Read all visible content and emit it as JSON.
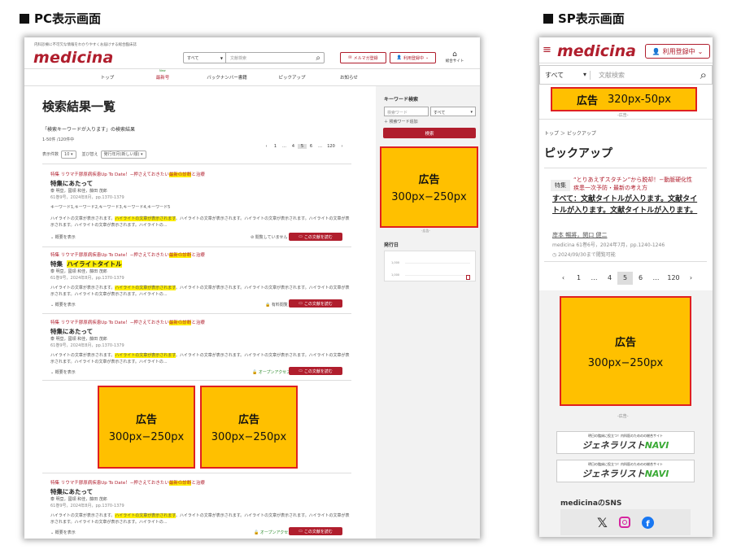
{
  "labels": {
    "pc": "PC表示画面",
    "sp": "SP表示画面"
  },
  "pc": {
    "tagline": "内科診療に不可欠な情報をわかりやすくお届けする総合臨床誌",
    "logo": "medicina",
    "search_select": "すべて",
    "search_placeholder": "文献検索",
    "mag_btn": "メルマガ登録",
    "reg_btn": "利用登録中",
    "sogo": "総合サイト",
    "nav": [
      {
        "label": "トップ"
      },
      {
        "label": "最新号",
        "badge": "New"
      },
      {
        "label": "バックナンバー書籍"
      },
      {
        "label": "ピックアップ"
      },
      {
        "label": "お知らせ"
      }
    ],
    "page_title": "検索結果一覧",
    "query_line": "「検索キーワードが入ります」の検索結果",
    "count": "1-50件 /120件中",
    "pages": [
      "‹",
      "1",
      "…",
      "4",
      "5",
      "6",
      "…",
      "120",
      "›"
    ],
    "per_page_label": "表示件数",
    "per_page": "10",
    "sort_label": "並び替え",
    "sort": "発行年月(新しい順)",
    "kw_tags": "キーワード1,キーワード2,キーワード3,キーワード4,キーワード5",
    "results": [
      {
        "tag": "特集 リウマチ膠原病疾患Up To Date！−押さえておきたい",
        "tag_hl": "最新の診断",
        "tag_end": "と治療",
        "title": "特集にあたって",
        "authors": "泰 明亘，國領 和佳，藤田 茂郎",
        "meta": "61巻9号，2024年8月，pp.1370-1379",
        "status": "閲覧していません",
        "read": "この文献を読む"
      },
      {
        "tag": "特集 リウマチ膠原病疾患Up To Date！−押さえておきたい",
        "tag_hl": "最新の診断",
        "tag_end": "と治療",
        "title": "特集",
        "title_hl": "ハイライトタイトル",
        "authors": "泰 明亘，國領 和佳，藤田 茂郎",
        "meta": "61巻9号，2024年8月，pp.1370-1379",
        "status": "有料閲覧",
        "read": "この文献を読む"
      },
      {
        "tag": "特集 リウマチ膠原病疾患Up To Date！−押さえておきたい",
        "tag_hl": "最新の診断",
        "tag_end": "と治療",
        "title": "特集にあたって",
        "authors": "泰 明亘，國領 和佳，藤田 茂郎",
        "meta": "61巻9号，2024年8月，pp.1370-1379",
        "status": "オープンアクセス",
        "read": "この文献を読む"
      },
      {
        "tag": "特集 リウマチ膠原病疾患Up To Date！−押さえておきたい",
        "tag_hl": "最新の診断",
        "tag_end": "と治療",
        "title": "特集にあたって",
        "authors": "泰 明亘，國領 和佳，藤田 茂郎",
        "meta": "61巻9号，2024年8月，pp.1370-1379",
        "status": "オープンアクセス",
        "read": "この文献を読む"
      }
    ],
    "snippet_a": "ハイライトの文章が表示されます。",
    "snippet_hl": "ハイライトの文章が表示されます",
    "snippet_b": "。ハイライトの文章が表示されます。ハイライトの文章が表示されます。ハイライトの文章が表示されます。ハイライトの文章が表示されます。ハイライトの...",
    "summary": "概要を表示",
    "side": {
      "kw_title": "キーワード検索",
      "kw_placeholder": "検索ワード",
      "kw_select": "すべて",
      "kw_add": "検索ワード追加",
      "search_btn": "検索",
      "issue_title": "発行日",
      "y1": "1,000",
      "y2": "1,000"
    },
    "ad_label": "広告",
    "ad_size": "300px−250px",
    "ad_caption": "-広告-"
  },
  "sp": {
    "logo": "medicina",
    "reg": "利用登録中",
    "select": "すべて",
    "placeholder": "文献検索",
    "ad_top_label": "広告",
    "ad_top_size": "320px-50px",
    "ad_caption": "-広告-",
    "breadcrumb": "トップ ＞ ピックアップ",
    "title": "ピックアップ",
    "tag": "特集",
    "tag_text": "“とりあえずスタチン”から脱却！−動脈硬化性疾患一次予防・最新の考え方",
    "article_title": "すべて：文献タイトルが入ります。文献タイトルが入ります。文献タイトルが入ります。",
    "authors": "岸本 暢將，関口 健二",
    "meta": "medicina 61巻6号，2024年7月，pp.1240-1246",
    "limit": "2024/09/30まで閲覧可能",
    "pages": [
      "‹",
      "1",
      "…",
      "4",
      "5",
      "6",
      "…",
      "120",
      "›"
    ],
    "ad_label": "広告",
    "ad_size": "300px−250px",
    "banner_sub": "明日の臨床に役立つ！内科医のためのの総合サイト",
    "banner_main": "ジェネラリスト",
    "banner_navi": "NAVI",
    "sns_title": "medicinaのSNS"
  },
  "colors": {
    "brand": "#b01e2d",
    "ad": "#ffc000",
    "ad_border": "#e02020"
  }
}
